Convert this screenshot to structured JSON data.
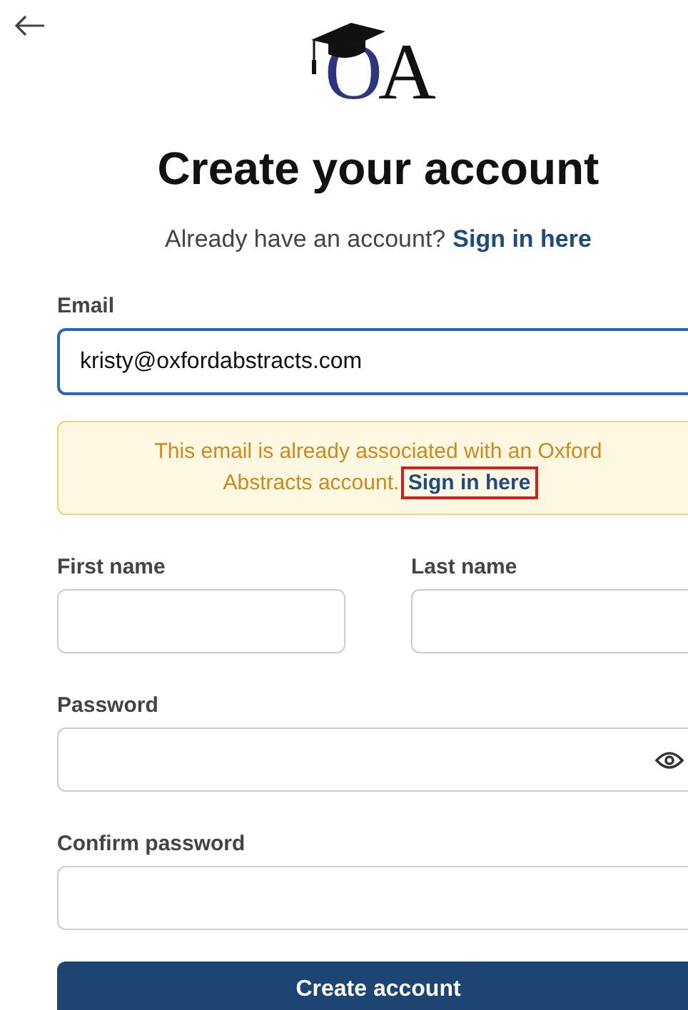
{
  "logo": {
    "letters": [
      {
        "text": "O",
        "color": "#2e3580"
      },
      {
        "text": "A",
        "color": "#111111"
      }
    ]
  },
  "title": "Create your account",
  "signin_prompt": {
    "text": "Already have an account?",
    "link": "Sign in here"
  },
  "email": {
    "label": "Email",
    "value": "kristy@oxfordabstracts.com",
    "focused": true
  },
  "alert": {
    "text": "This email is already associated with an Oxford Abstracts account.",
    "link": "Sign in here",
    "link_highlighted": true
  },
  "name_fields": [
    {
      "label": "First name"
    },
    {
      "label": "Last name"
    }
  ],
  "password": {
    "label": "Password"
  },
  "confirm_password": {
    "label": "Confirm password"
  },
  "submit": "Create account"
}
